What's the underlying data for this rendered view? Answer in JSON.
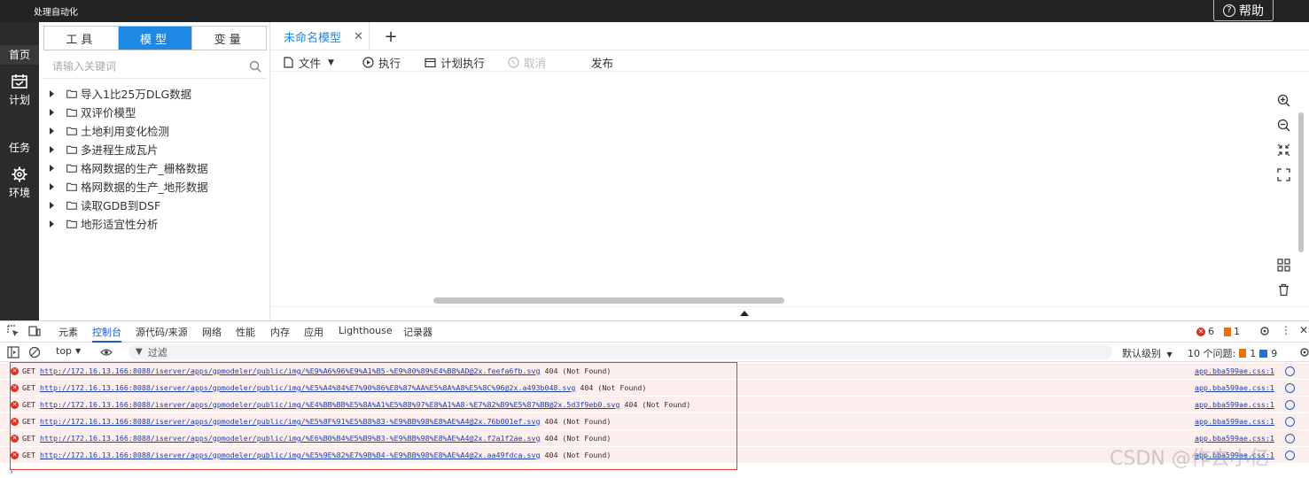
{
  "app": {
    "title": "处理自动化",
    "help_label": "帮助"
  },
  "leftnav": {
    "items": [
      {
        "label": "首页",
        "icon": "home-icon"
      },
      {
        "label": "计划",
        "icon": "calendar-icon"
      },
      {
        "label": "任务",
        "icon": "task-icon"
      },
      {
        "label": "环境",
        "icon": "gear-icon"
      }
    ]
  },
  "side_panel": {
    "tabs": [
      "工具",
      "模型",
      "变量"
    ],
    "active_tab": "模型",
    "search_placeholder": "请输入关键词",
    "tree": [
      "导入1比25万DLG数据",
      "双评价模型",
      "土地利用变化检测",
      "多进程生成瓦片",
      "格网数据的生产_栅格数据",
      "格网数据的生产_地形数据",
      "读取GDB到DSF",
      "地形适宜性分析"
    ]
  },
  "main": {
    "tab_label": "未命名模型",
    "toolbar": {
      "file": "文件",
      "run": "执行",
      "schedule": "计划执行",
      "cancel": "取消",
      "publish": "发布"
    }
  },
  "devtools": {
    "tabs": [
      "元素",
      "控制台",
      "源代码/来源",
      "网络",
      "性能",
      "内存",
      "应用",
      "Lighthouse",
      "记录器"
    ],
    "active_tab": "控制台",
    "error_count": "6",
    "warning_count": "1",
    "context": "top",
    "filter_placeholder": "过滤",
    "level": "默认级别",
    "issues_label": "10 个问题:",
    "issues_warn": "1",
    "issues_info": "9",
    "logs": [
      {
        "method": "GET",
        "url": "http://172.16.13.166:8088/iserver/apps/gpmodeler/public/img/%E9%A6%96%E9%A1%B5-%E9%80%89%E4%B8%AD@2x.feefa6fb.svg",
        "status": "404 (Not Found)",
        "source": "app.bba599ae.css:1"
      },
      {
        "method": "GET",
        "url": "http://172.16.13.166:8088/iserver/apps/gpmodeler/public/img/%E5%A4%84%E7%90%86%E8%87%AA%E5%8A%A8%E5%8C%96@2x.a493b048.svg",
        "status": "404 (Not Found)",
        "source": "app.bba599ae.css:1"
      },
      {
        "method": "GET",
        "url": "http://172.16.13.166:8088/iserver/apps/gpmodeler/public/img/%E4%BB%BB%E5%8A%A1%E5%88%97%E8%A1%A8-%E7%82%B9%E5%87%BB@2x.5d3f9eb0.svg",
        "status": "404 (Not Found)",
        "source": "app.bba599ae.css:1"
      },
      {
        "method": "GET",
        "url": "http://172.16.13.166:8088/iserver/apps/gpmodeler/public/img/%E5%8F%91%E5%B8%83-%E9%BB%98%E8%AE%A4@2x.76b001ef.svg",
        "status": "404 (Not Found)",
        "source": "app.bba599ae.css:1"
      },
      {
        "method": "GET",
        "url": "http://172.16.13.166:8088/iserver/apps/gpmodeler/public/img/%E6%B0%B4%E5%B9%B3-%E9%BB%98%E8%AE%A4@2x.f2a1f2ae.svg",
        "status": "404 (Not Found)",
        "source": "app.bba599ae.css:1"
      },
      {
        "method": "GET",
        "url": "http://172.16.13.166:8088/iserver/apps/gpmodeler/public/img/%E5%9E%82%E7%9B%B4-%E9%BB%98%E8%AE%A4@2x.aa49fdca.svg",
        "status": "404 (Not Found)",
        "source": "app.bba599ae.css:1"
      }
    ]
  },
  "watermark": "CSDN @作去小亿"
}
